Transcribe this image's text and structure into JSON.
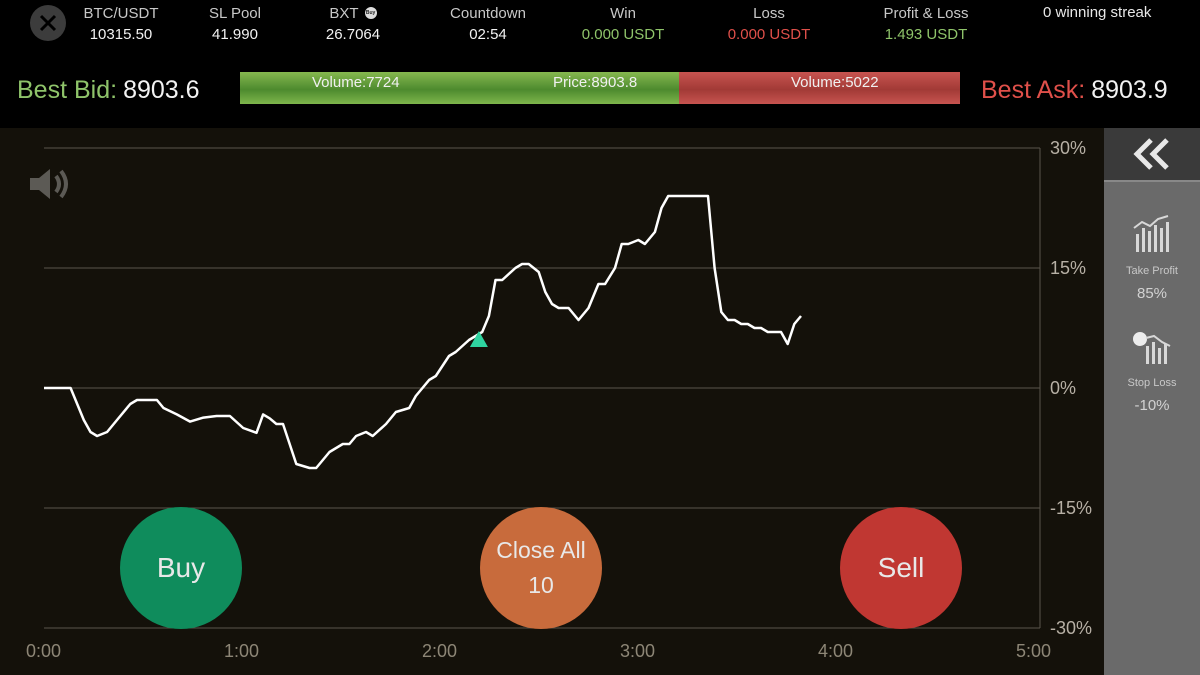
{
  "topbar": {
    "stats": [
      {
        "label": "BTC/USDT",
        "value": "10315.50"
      },
      {
        "label": "SL Pool",
        "value": "41.990"
      },
      {
        "label": "BXT",
        "value": "26.7064",
        "badge": "Buy"
      },
      {
        "label": "Countdown",
        "value": "02:54"
      },
      {
        "label": "Win",
        "value": "0.000 USDT"
      },
      {
        "label": "Loss",
        "value": "0.000 USDT"
      },
      {
        "label": "Profit & Loss",
        "value": "1.493 USDT"
      }
    ],
    "streak": "0 winning streak"
  },
  "bidask": {
    "best_bid_label": "Best Bid:",
    "best_bid_value": "8903.6",
    "best_ask_label": "Best Ask:",
    "best_ask_value": "8903.9",
    "buy_volume": "Volume:7724",
    "price": "Price:8903.8",
    "sell_volume": "Volume:5022"
  },
  "chart_data": {
    "type": "line",
    "ylabels": [
      "30%",
      "15%",
      "0%",
      "-15%",
      "-30%"
    ],
    "xlabels": [
      "0:00",
      "1:00",
      "2:00",
      "3:00",
      "4:00",
      "5:00"
    ],
    "ylim": [
      -30,
      30
    ],
    "xlim": [
      0,
      300
    ],
    "series": [
      {
        "x": [
          0,
          8,
          12,
          14,
          16,
          19,
          22,
          26,
          28,
          34,
          36,
          40,
          44,
          48,
          52,
          56,
          60,
          64,
          66,
          68,
          70,
          72,
          76,
          80,
          82,
          86,
          90,
          92,
          94,
          97,
          99,
          103,
          106,
          110,
          112,
          116,
          118,
          122,
          124,
          128,
          132,
          134,
          136,
          138,
          142,
          144,
          146,
          149,
          151,
          153,
          155,
          158,
          161,
          164,
          167,
          169,
          172,
          174,
          176,
          179,
          181,
          184,
          186,
          188,
          190,
          192,
          194,
          196,
          198,
          200,
          202,
          204,
          206,
          208,
          210,
          212,
          214,
          216,
          218,
          220,
          222,
          224,
          226,
          228
        ],
        "y": [
          0,
          0,
          -4,
          -5.5,
          -6,
          -5.5,
          -4,
          -2,
          -1.5,
          -1.5,
          -2.5,
          -3.3,
          -4.2,
          -3.7,
          -3.5,
          -3.5,
          -5,
          -5.6,
          -3.3,
          -3.8,
          -4.5,
          -4.5,
          -9.5,
          -10,
          -10,
          -8,
          -7,
          -7,
          -6,
          -5.5,
          -6,
          -4.5,
          -3,
          -2.5,
          -1,
          1,
          1.5,
          4,
          4.5,
          6,
          7,
          9,
          13.5,
          13.5,
          15,
          15.5,
          15.5,
          14.5,
          12,
          10.5,
          10,
          10,
          8.5,
          10,
          13,
          13,
          15,
          18,
          18,
          18.5,
          18,
          19.5,
          22.5,
          24,
          24,
          24,
          24,
          24,
          24,
          24,
          15,
          9.5,
          8.5,
          8.5,
          8,
          8,
          7.5,
          7.5,
          7,
          7,
          7,
          5.5,
          8,
          9
        ]
      }
    ],
    "marker": {
      "type": "triangle-up",
      "x": 131,
      "y": 6,
      "color": "#2fd4a0"
    },
    "line_color": "#ffffff",
    "grid": true,
    "background": "#14110a"
  },
  "buttons": {
    "buy": "Buy",
    "close_all": "Close All",
    "close_all_count": "10",
    "sell": "Sell"
  },
  "right_panel": {
    "take_profit_label": "Take Profit",
    "take_profit_value": "85%",
    "stop_loss_label": "Stop Loss",
    "stop_loss_value": "-10%"
  },
  "colors": {
    "green": "#8fc46a",
    "red": "#e0504a",
    "buy_btn": "#0f8c5c",
    "close_btn": "#c86b3c",
    "sell_btn": "#c03732"
  }
}
